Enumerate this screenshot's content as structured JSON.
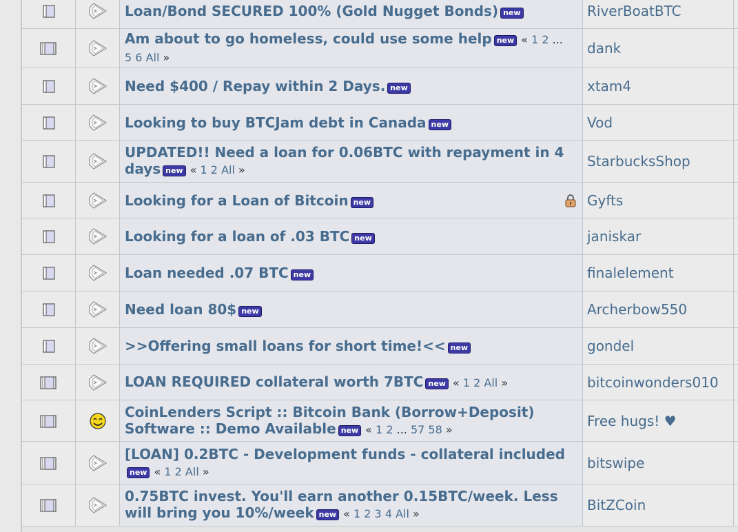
{
  "topics": [
    {
      "title": "Loan/Bond SECURED 100% (Gold Nugget Bonds)",
      "badge": "new",
      "starter": "RiverBoatBTC",
      "icon": "normal-topic-icon",
      "msg_icon": "xx-post-icon",
      "pages": null,
      "locked": false
    },
    {
      "title": "Am about to go homeless, could use some help",
      "badge": "new",
      "starter": "dank",
      "icon": "hot-topic-icon",
      "msg_icon": "xx-post-icon",
      "pages": [
        "«",
        "1",
        "2",
        "...",
        "5",
        "6",
        "All",
        "»"
      ],
      "locked": false
    },
    {
      "title": "Need $400 / Repay within 2 Days.",
      "badge": "new",
      "starter": "xtam4",
      "icon": "normal-topic-icon",
      "msg_icon": "xx-post-icon",
      "pages": null,
      "locked": false
    },
    {
      "title": "Looking to buy BTCJam debt in Canada",
      "badge": "new",
      "starter": "Vod",
      "icon": "normal-topic-icon",
      "msg_icon": "xx-post-icon",
      "pages": null,
      "locked": false
    },
    {
      "title": "UPDATED!! Need a loan for 0.06BTC with repayment in 4 days",
      "badge": "new",
      "starter": "StarbucksShop",
      "icon": "normal-topic-icon",
      "msg_icon": "xx-post-icon",
      "pages": [
        "«",
        "1",
        "2",
        "All",
        "»"
      ],
      "locked": false
    },
    {
      "title": "Looking for a Loan of Bitcoin",
      "badge": "new",
      "starter": "Gyfts",
      "icon": "normal-topic-icon",
      "msg_icon": "xx-post-icon",
      "pages": null,
      "locked": true
    },
    {
      "title": "Looking for a loan of .03 BTC",
      "badge": "new",
      "starter": "janiskar",
      "icon": "normal-topic-icon",
      "msg_icon": "xx-post-icon",
      "pages": null,
      "locked": false
    },
    {
      "title": "Loan needed .07 BTC",
      "badge": "new",
      "starter": "finalelement",
      "icon": "normal-topic-icon",
      "msg_icon": "xx-post-icon",
      "pages": null,
      "locked": false
    },
    {
      "title": "Need loan 80$",
      "badge": "new",
      "starter": "Archerbow550",
      "icon": "normal-topic-icon",
      "msg_icon": "xx-post-icon",
      "pages": null,
      "locked": false
    },
    {
      "title": ">>Offering small loans for short time!<<",
      "badge": "new",
      "starter": "gondel",
      "icon": "normal-topic-icon",
      "msg_icon": "xx-post-icon",
      "pages": null,
      "locked": false
    },
    {
      "title": "LOAN REQUIRED collateral worth 7BTC",
      "badge": "new",
      "starter": "bitcoinwonders010",
      "icon": "hot-topic-icon",
      "msg_icon": "xx-post-icon",
      "pages": [
        "«",
        "1",
        "2",
        "All",
        "»"
      ],
      "locked": false
    },
    {
      "title": "CoinLenders Script :: Bitcoin Bank (Borrow+Deposit) Software :: Demo Available",
      "badge": "new",
      "starter": "Free hugs! ♥",
      "icon": "hot-topic-icon",
      "msg_icon": "smiley-icon",
      "pages": [
        "«",
        "1",
        "2",
        "...",
        "57",
        "58",
        "»"
      ],
      "locked": false
    },
    {
      "title": "[LOAN] 0.2BTC - Development funds - collateral included",
      "badge": "new",
      "starter": "bitswipe",
      "icon": "hot-topic-icon",
      "msg_icon": "xx-post-icon",
      "pages": [
        "«",
        "1",
        "2",
        "All",
        "»"
      ],
      "locked": false
    },
    {
      "title": "0.75BTC invest. You'll earn another 0.15BTC/week. Less will bring you 10%/week",
      "badge": "new",
      "starter": "BitZCoin",
      "icon": "hot-topic-icon",
      "msg_icon": "xx-post-icon",
      "pages": [
        "«",
        "1",
        "2",
        "3",
        "4",
        "All",
        "»"
      ],
      "locked": false
    }
  ]
}
